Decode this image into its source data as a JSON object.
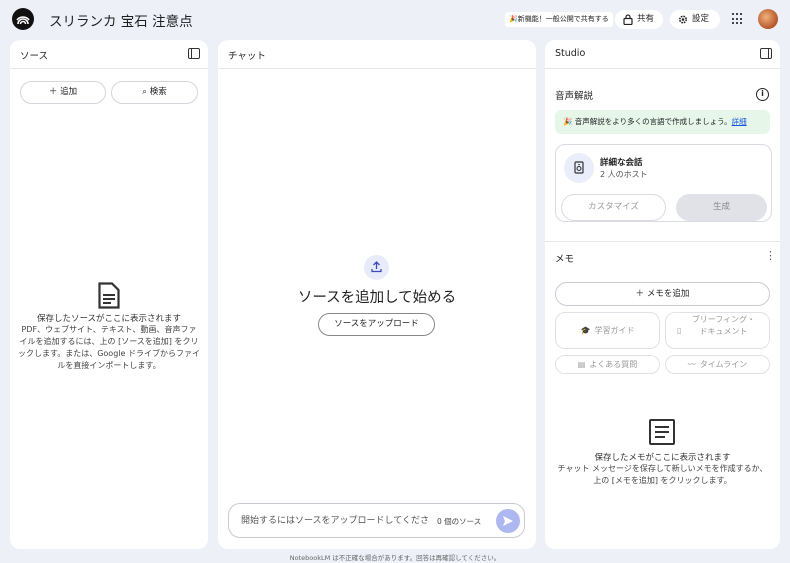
{
  "header": {
    "app_title": "スリランカ 宝石 注意点",
    "announcement": "新機能！一般公開で共有する",
    "share_label": "共有",
    "settings_label": "設定"
  },
  "sources": {
    "title": "ソース",
    "add_label": "＋ 追加",
    "search_label": "検索",
    "empty_title": "保存したソースがここに表示されます",
    "empty_body": "PDF、ウェブサイト、テキスト、動画、音声ファイルを追加するには、上の [ソースを追加] をクリックします。または、Google ドライブからファイルを直接インポートします。"
  },
  "chat": {
    "title": "チャット",
    "heading": "ソースを追加して始める",
    "upload_label": "ソースをアップロード",
    "input_placeholder": "開始するにはソースをアップロードしてください",
    "source_count": "0 個のソース"
  },
  "studio": {
    "title": "Studio",
    "audio_title": "音声解説",
    "audio_banner": "音声解説をより多くの言語で作成しましょう。",
    "audio_banner_link": "詳細",
    "conversation_title": "詳細な会話",
    "conversation_sub": "2 人のホスト",
    "customize_label": "カスタマイズ",
    "generate_label": "生成",
    "memo_title": "メモ",
    "add_memo_label": "＋  メモを追加",
    "chips": {
      "study_guide": "学習ガイド",
      "briefing_doc": "ブリーフィング・ドキュメント",
      "faq": "よくある質問",
      "timeline": "タイムライン"
    },
    "memo_empty_title": "保存したメモがここに表示されます",
    "memo_empty_body": "チャット メッセージを保存して新しいメモを作成するか、上の [メモを追加] をクリックします。"
  },
  "footer": {
    "note": "NotebookLM は不正確な場合があります。回答は再確認してください。"
  },
  "colors": {
    "background": "#eef0f8",
    "banner_green": "#e6f7ea",
    "send_button": "#aeb8f0",
    "link": "#1a56db"
  }
}
